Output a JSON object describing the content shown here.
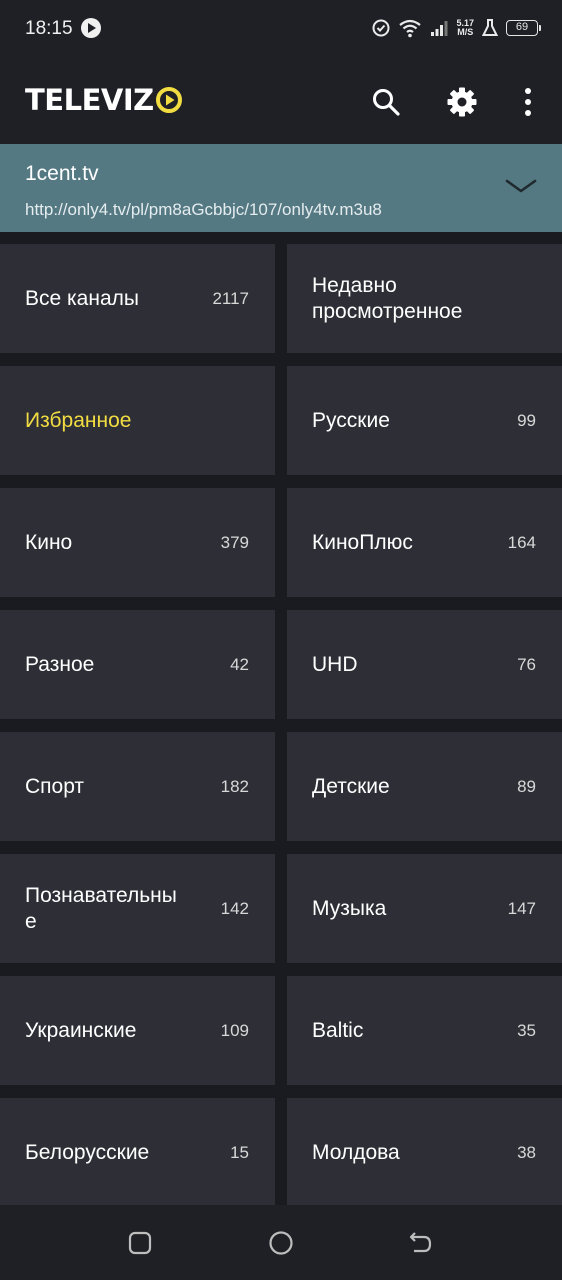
{
  "status_bar": {
    "time": "18:15",
    "net_speed_value": "5.17",
    "net_speed_unit": "M/S",
    "battery": "69"
  },
  "app_bar": {
    "logo_text": "TELEVIZ",
    "icons": [
      "search-icon",
      "settings-icon",
      "more-vert-icon"
    ]
  },
  "playlist": {
    "name": "1cent.tv",
    "url": "http://only4.tv/pl/pm8aGcbbjc/107/only4tv.m3u8"
  },
  "categories": [
    {
      "label": "Все каналы",
      "count": "2117"
    },
    {
      "label": "Недавно просмотренное",
      "count": ""
    },
    {
      "label": "Избранное",
      "count": ""
    },
    {
      "label": "Русские",
      "count": "99"
    },
    {
      "label": "Кино",
      "count": "379"
    },
    {
      "label": "КиноПлюс",
      "count": "164"
    },
    {
      "label": "Разное",
      "count": "42"
    },
    {
      "label": "UHD",
      "count": "76"
    },
    {
      "label": "Спорт",
      "count": "182"
    },
    {
      "label": "Детские",
      "count": "89"
    },
    {
      "label": "Познавательные",
      "count": "142"
    },
    {
      "label": "Музыка",
      "count": "147"
    },
    {
      "label": "Украинские",
      "count": "109"
    },
    {
      "label": "Baltic",
      "count": "35"
    },
    {
      "label": "Белорусские",
      "count": "15"
    },
    {
      "label": "Молдова",
      "count": "38"
    }
  ],
  "colors": {
    "accent_yellow": "#f1dc41",
    "playlist_bar": "#557983",
    "tile": "#2e2f36",
    "background": "#1a1b20"
  },
  "nav_bar": {
    "icons": [
      "recents-icon",
      "home-icon",
      "back-icon"
    ]
  }
}
